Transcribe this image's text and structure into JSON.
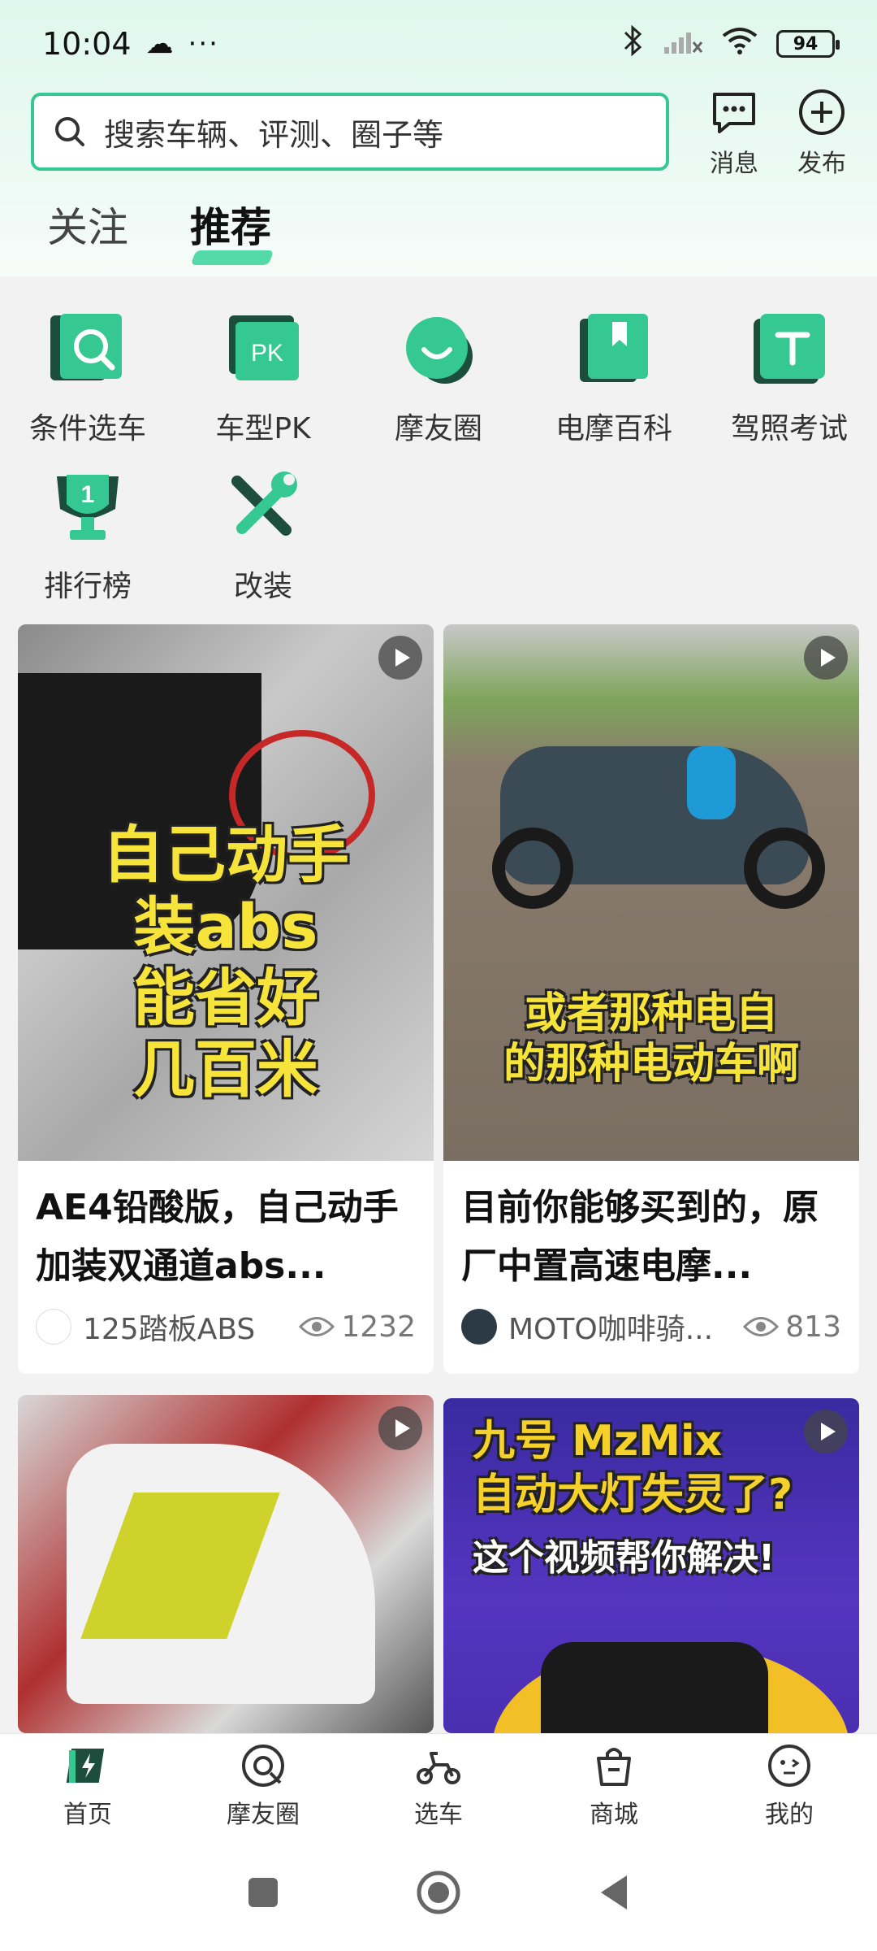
{
  "status_bar": {
    "time": "10:04",
    "battery": "94"
  },
  "search": {
    "placeholder": "搜索车辆、评测、圈子等"
  },
  "top_actions": {
    "messages_label": "消息",
    "publish_label": "发布"
  },
  "tabs": [
    {
      "label": "关注"
    },
    {
      "label": "推荐",
      "active": true
    }
  ],
  "features": [
    {
      "label": "条件选车",
      "icon": "search-car-icon"
    },
    {
      "label": "车型PK",
      "icon": "pk-icon"
    },
    {
      "label": "摩友圈",
      "icon": "chat-circle-icon"
    },
    {
      "label": "电摩百科",
      "icon": "book-icon"
    },
    {
      "label": "驾照考试",
      "icon": "license-icon"
    },
    {
      "label": "排行榜",
      "icon": "trophy-icon"
    },
    {
      "label": "改装",
      "icon": "wrench-icon"
    }
  ],
  "feed": [
    {
      "overlay": [
        "自己动手",
        "装abs",
        "能省好",
        "几百米"
      ],
      "title": "AE4铅酸版，自己动手加装双通道abs...",
      "author": "125踏板ABS",
      "views": "1232"
    },
    {
      "overlay": [
        "或者那种电自",
        "的那种电动车啊"
      ],
      "title": "目前你能够买到的，原厂中置高速电摩...",
      "author": "MOTO咖啡骑...",
      "views": "813"
    },
    {
      "overlay": [],
      "title": "",
      "author": "",
      "views": ""
    },
    {
      "overlay": [
        "九号 MzMix",
        "自动大灯失灵了?",
        "这个视频帮你解决!"
      ],
      "title": "",
      "author": "",
      "views": ""
    }
  ],
  "bottom_nav": [
    {
      "label": "首页",
      "icon": "home-icon",
      "active": true
    },
    {
      "label": "摩友圈",
      "icon": "moto-circle-icon"
    },
    {
      "label": "选车",
      "icon": "scooter-icon"
    },
    {
      "label": "商城",
      "icon": "shopping-bag-icon"
    },
    {
      "label": "我的",
      "icon": "profile-icon"
    }
  ],
  "colors": {
    "accent": "#35c893",
    "accent_dark": "#1e9e73",
    "background": "#f2f2f2"
  }
}
